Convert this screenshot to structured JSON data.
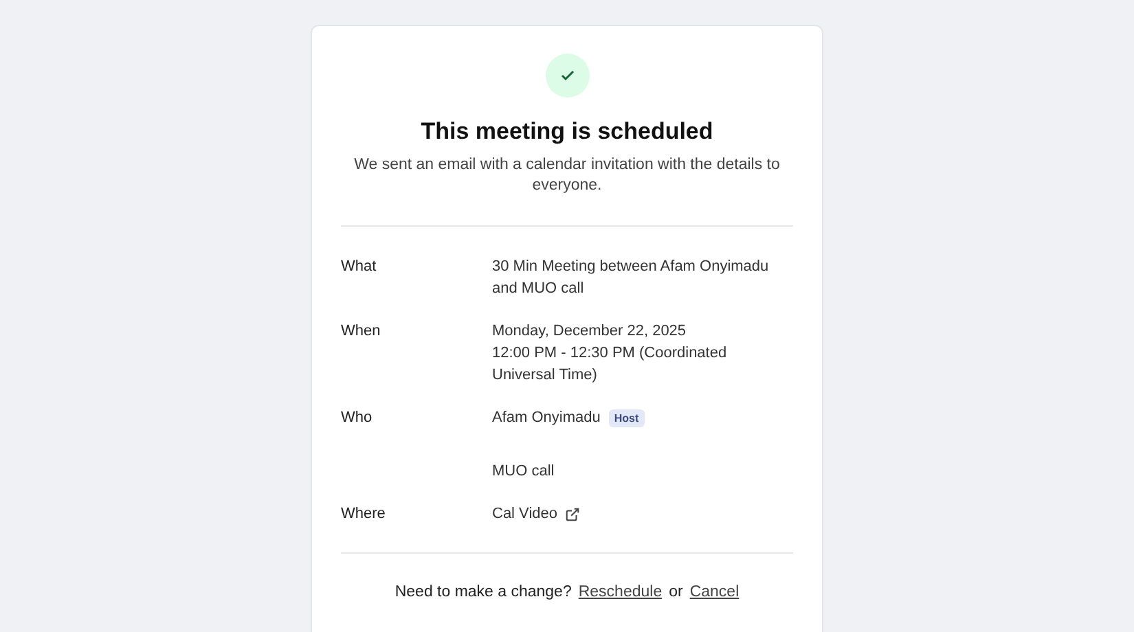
{
  "title": "This meeting is scheduled",
  "subtitle": "We sent an email with a calendar invitation with the details to everyone.",
  "details": [
    {
      "kind": "text",
      "label": "What",
      "lines": [
        "30 Min Meeting between Afam Onyimadu and MUO call"
      ]
    },
    {
      "kind": "text",
      "label": "When",
      "lines": [
        "Monday, December 22, 2025",
        "12:00 PM - 12:30 PM (Coordinated Universal Time)"
      ]
    },
    {
      "kind": "people",
      "label": "Who",
      "people": [
        {
          "name": "Afam Onyimadu",
          "badge": "Host"
        },
        {
          "name": "MUO call"
        }
      ]
    },
    {
      "kind": "link",
      "label": "Where",
      "link": "Cal Video"
    }
  ],
  "footer": {
    "prompt": "Need to make a change?",
    "reschedule": "Reschedule",
    "separator": "or",
    "cancel": "Cancel"
  }
}
